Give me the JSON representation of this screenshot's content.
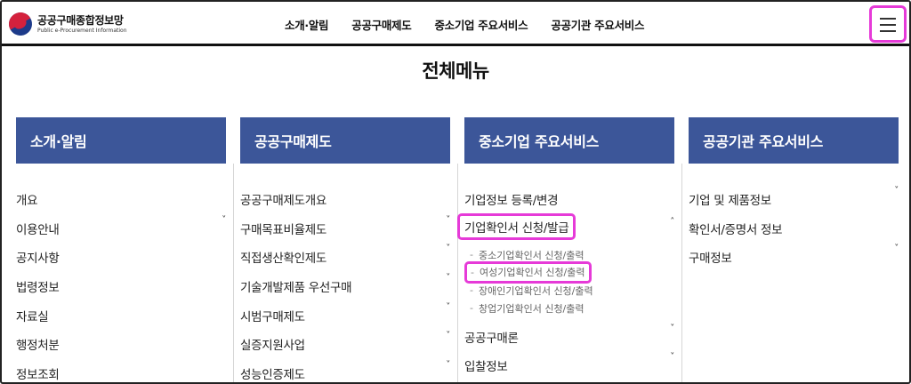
{
  "header": {
    "logo_ko": "공공구매종합정보망",
    "logo_en": "Public e-Procurement Information",
    "nav": [
      "소개·알림",
      "공공구매제도",
      "중소기업 주요서비스",
      "공공기관 주요서비스"
    ]
  },
  "page_title": "전체메뉴",
  "columns": [
    {
      "title": "소개·알림",
      "items": [
        "개요",
        "이용안내",
        "공지사항",
        "법령정보",
        "자료실",
        "행정처분",
        "정보조회"
      ]
    },
    {
      "title": "공공구매제도",
      "items": [
        "공공구매제도개요",
        "구매목표비율제도",
        "직접생산확인제도",
        "기술개발제품 우선구매",
        "시범구매제도",
        "실증지원사업",
        "성능인증제도"
      ]
    },
    {
      "title": "중소기업 주요서비스",
      "items": [
        "기업정보 등록/변경",
        "기업확인서 신청/발급",
        "공공구매론",
        "입찰정보"
      ],
      "subitems": [
        "중소기업확인서 신청/출력",
        "여성기업확인서 신청/출력",
        "장애인기업확인서 신청/출력",
        "창업기업확인서 신청/출력"
      ]
    },
    {
      "title": "공공기관 주요서비스",
      "items": [
        "기업 및 제품정보",
        "확인서/증명서 정보",
        "구매정보"
      ]
    }
  ],
  "icons": {
    "chevron_down": "˅",
    "chevron_up": "˄",
    "dash": "-"
  },
  "colors": {
    "column_header": "#3c5699",
    "highlight": "#e63ad8"
  }
}
